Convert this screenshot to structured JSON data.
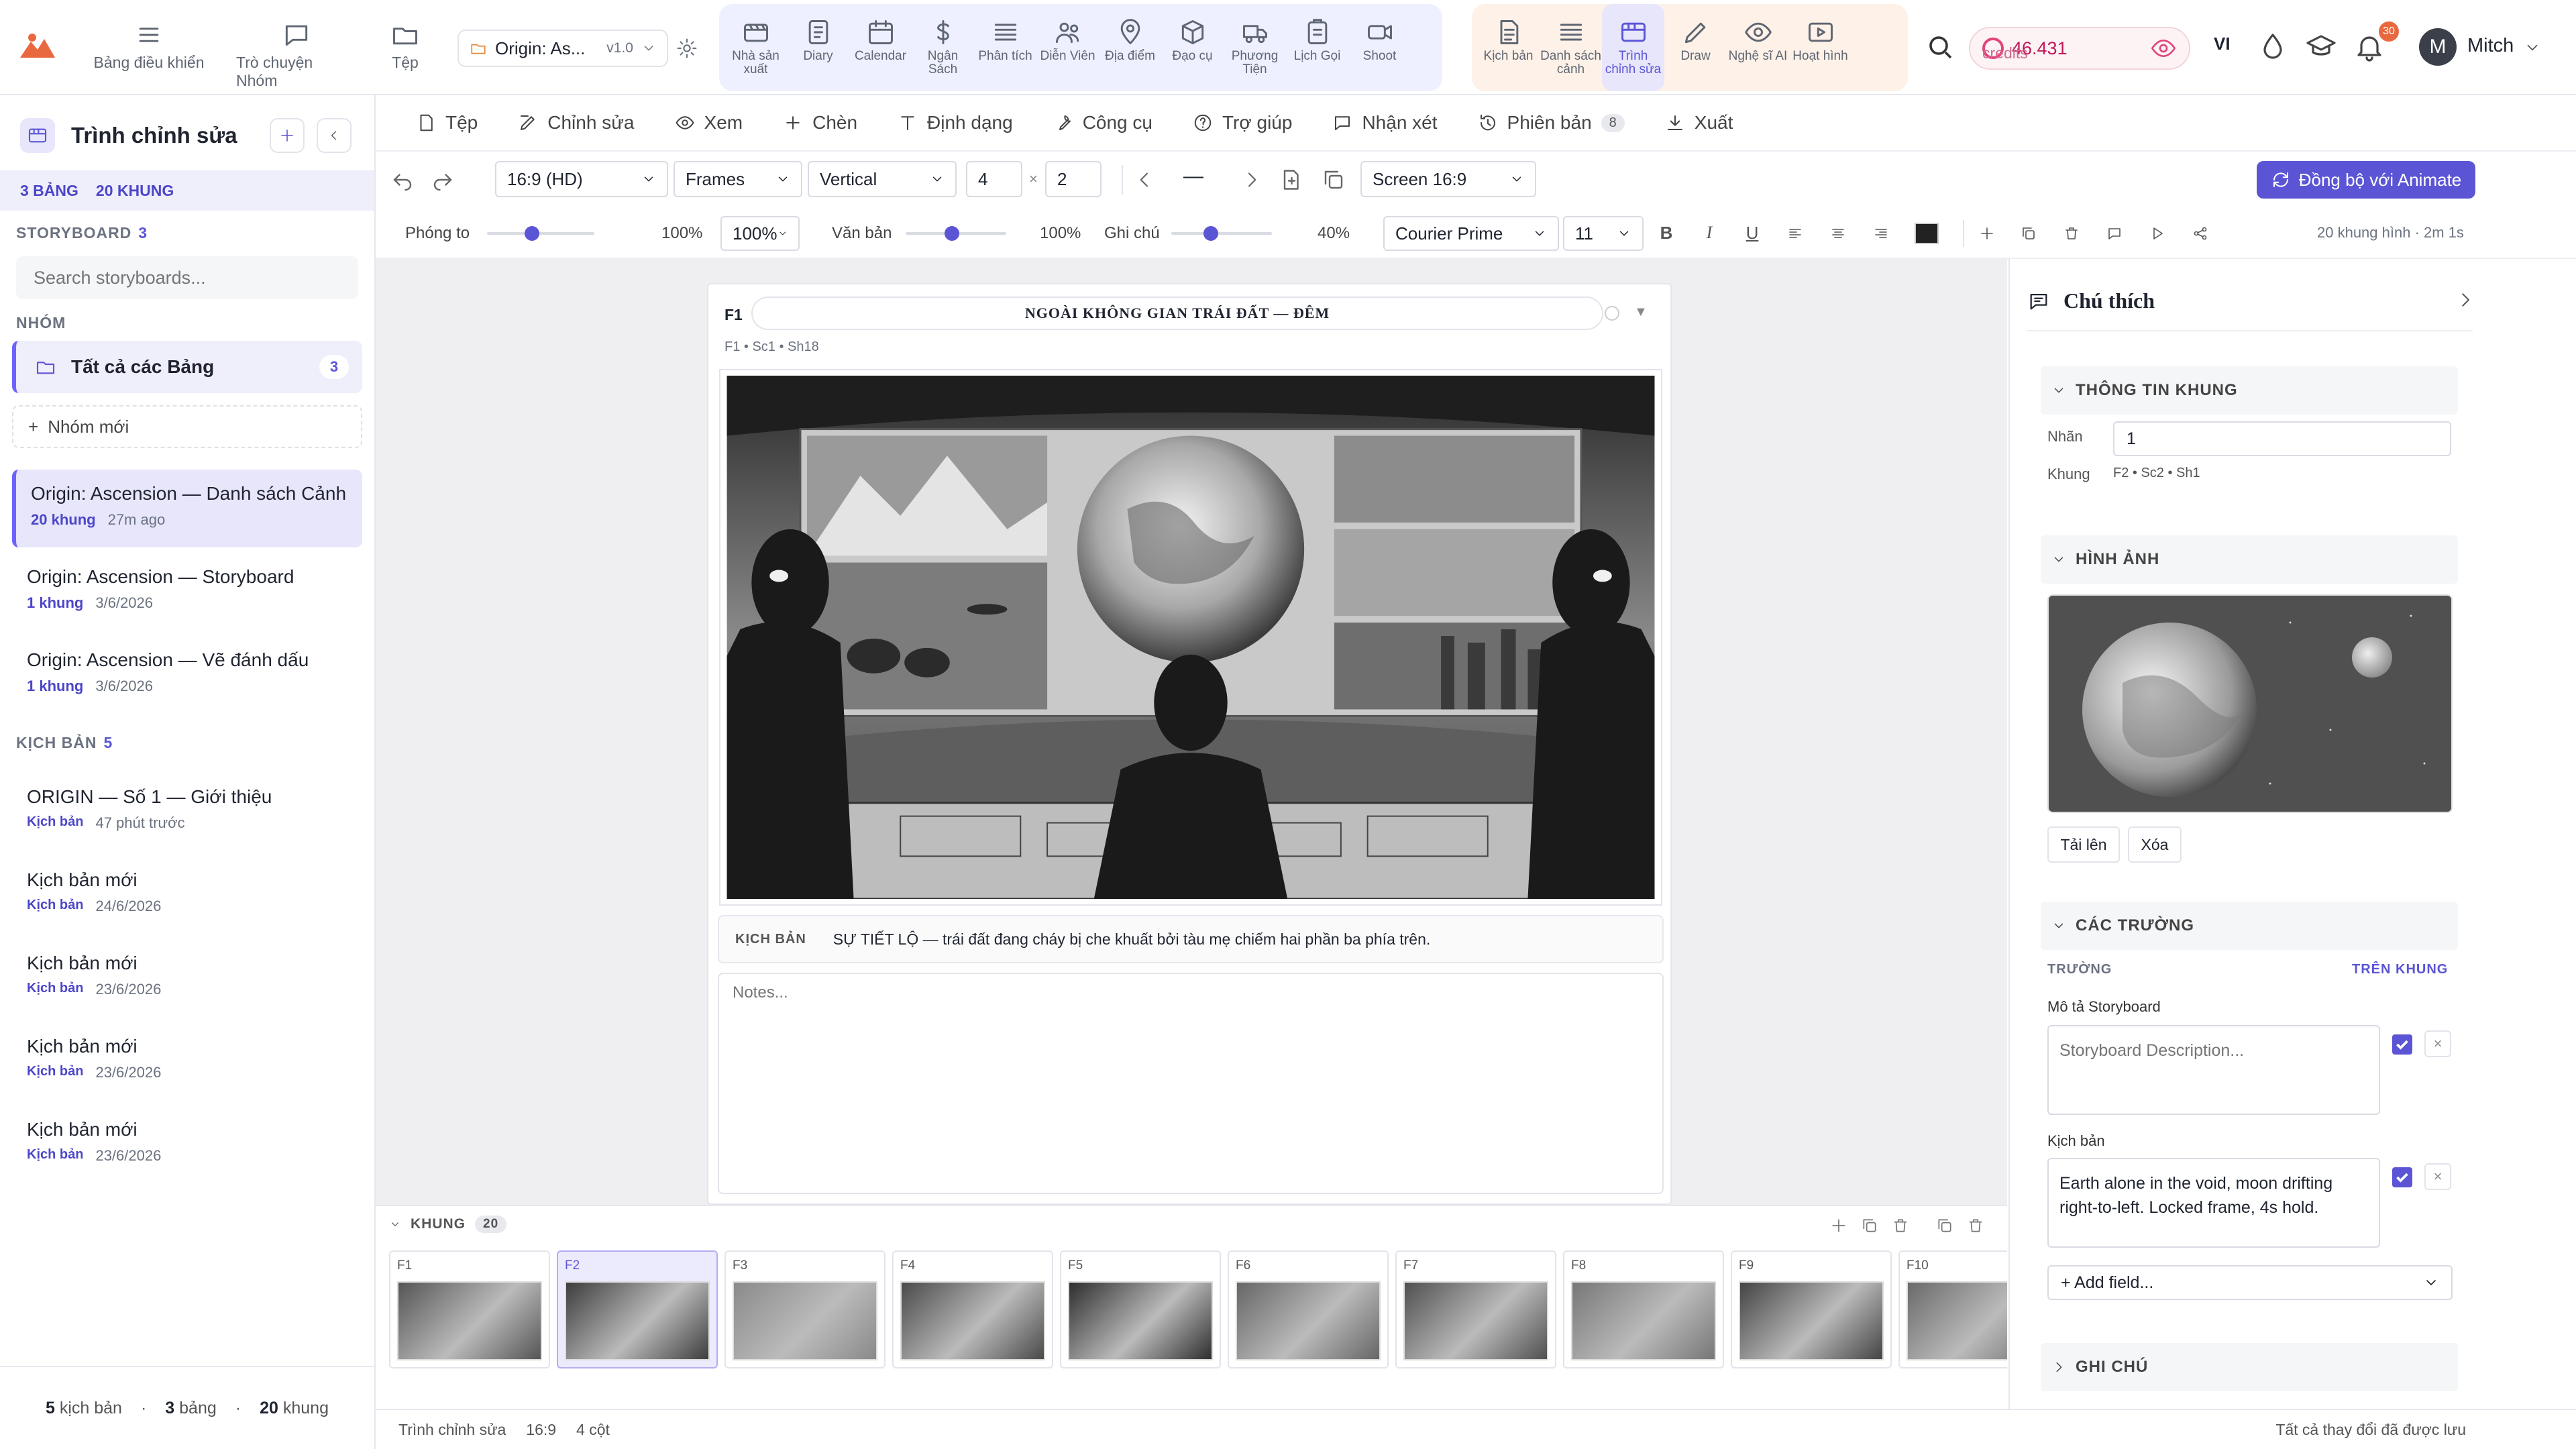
{
  "topbar": {
    "nav": [
      {
        "label": "Bảng điều khiển",
        "icon": "menu-icon"
      },
      {
        "label": "Trò chuyện Nhóm",
        "icon": "chat-icon"
      },
      {
        "label": "Tệp",
        "icon": "folder-icon"
      }
    ],
    "project": {
      "name": "Origin: As...",
      "version": "v1.0"
    },
    "tools": [
      {
        "label": "Nhà sản xuất",
        "icon": "producer-icon"
      },
      {
        "label": "Diary",
        "icon": "diary-icon"
      },
      {
        "label": "Calendar",
        "icon": "calendar-icon"
      },
      {
        "label": "Ngân Sách",
        "icon": "dollar-icon"
      },
      {
        "label": "Phân tích",
        "icon": "breakdown-icon"
      },
      {
        "label": "Diễn Viên",
        "icon": "cast-icon"
      },
      {
        "label": "Địa điểm",
        "icon": "location-icon"
      },
      {
        "label": "Đạo cụ",
        "icon": "props-icon"
      },
      {
        "label": "Phương Tiện",
        "icon": "vehicle-icon"
      },
      {
        "label": "Lịch Gọi",
        "icon": "callsheet-icon"
      },
      {
        "label": "Shoot",
        "icon": "camera-icon"
      }
    ],
    "tools2": [
      {
        "label": "Kịch bản",
        "icon": "script-icon"
      },
      {
        "label": "Danh sách cảnh",
        "icon": "list-icon"
      },
      {
        "label": "Trình chỉnh sửa",
        "icon": "storyboard-icon",
        "active": true
      },
      {
        "label": "Draw",
        "icon": "pen-icon"
      },
      {
        "label": "Nghệ sĩ AI",
        "icon": "eye-icon"
      },
      {
        "label": "Hoạt hình",
        "icon": "play-icon"
      }
    ],
    "credits": {
      "value": "46.431",
      "label": "credits"
    },
    "lang": "VI",
    "notif_count": "30",
    "user": {
      "initial": "M",
      "name": "Mitch"
    }
  },
  "sidebar": {
    "title": "Trình chỉnh sửa",
    "stats": {
      "boards": "3 BẢNG",
      "frames": "20 KHUNG"
    },
    "storyboard_label": "STORYBOARD",
    "storyboard_count": "3",
    "search_placeholder": "Search storyboards...",
    "group_label": "NHÓM",
    "all_boards": {
      "label": "Tất cả các Bảng",
      "count": "3"
    },
    "new_group": "Nhóm mới",
    "boards": [
      {
        "name": "Origin: Ascension — Danh sách Cảnh",
        "meta1": "20 khung",
        "meta2": "27m ago"
      },
      {
        "name": "Origin: Ascension — Storyboard",
        "meta1": "1 khung",
        "meta2": "3/6/2026"
      },
      {
        "name": "Origin: Ascension — Vẽ đánh dấu",
        "meta1": "1 khung",
        "meta2": "3/6/2026"
      }
    ],
    "script_label": "KỊCH BẢN",
    "script_count": "5",
    "scripts": [
      {
        "name": "ORIGIN — Số 1 — Giới thiệu",
        "meta1": "Kịch bản",
        "meta2": "47 phút trước"
      },
      {
        "name": "Kịch bản mới",
        "meta1": "Kịch bản",
        "meta2": "24/6/2026"
      },
      {
        "name": "Kịch bản mới",
        "meta1": "Kịch bản",
        "meta2": "23/6/2026"
      },
      {
        "name": "Kịch bản mới",
        "meta1": "Kịch bản",
        "meta2": "23/6/2026"
      },
      {
        "name": "Kịch bản mới",
        "meta1": "Kịch bản",
        "meta2": "23/6/2026"
      }
    ],
    "footer": {
      "scripts_n": "5",
      "scripts_l": "kịch bản",
      "boards_n": "3",
      "boards_l": "bảng",
      "frames_n": "20",
      "frames_l": "khung"
    }
  },
  "menu": [
    {
      "label": "Tệp",
      "icon": "file-icon"
    },
    {
      "label": "Chỉnh sửa",
      "icon": "edit-icon"
    },
    {
      "label": "Xem",
      "icon": "eye-icon"
    },
    {
      "label": "Chèn",
      "icon": "plus-icon"
    },
    {
      "label": "Định dạng",
      "icon": "text-icon"
    },
    {
      "label": "Công cụ",
      "icon": "wrench-icon"
    },
    {
      "label": "Trợ giúp",
      "icon": "help-icon"
    },
    {
      "label": "Nhận xét",
      "icon": "comment-icon"
    },
    {
      "label": "Phiên bản",
      "icon": "history-icon",
      "badge": "8"
    },
    {
      "label": "Xuất",
      "icon": "download-icon"
    }
  ],
  "toolbar": {
    "aspect": "16:9 (HD)",
    "mode": "Frames",
    "orientation": "Vertical",
    "cols": "4",
    "times": "×",
    "rows": "2",
    "zoom_dash": "—",
    "screen": "Screen 16:9",
    "sync_label": "Đồng bộ với Animate"
  },
  "toolbar2": {
    "zoom_label": "Phóng to",
    "zoom_value": "100%",
    "zoom_select": "100%",
    "text_label": "Văn bản",
    "text_value": "100%",
    "notes_label": "Ghi chú",
    "notes_value": "40%",
    "font": "Courier Prime",
    "size": "11",
    "bold": "B",
    "italic": "I",
    "underline": "U",
    "info": "20 khung hình · 2m 1s"
  },
  "frame": {
    "id": "F1",
    "heading": "NGOÀI KHÔNG GIAN TRÁI ĐẤT — ĐÊM",
    "sub": "F1 • Sc1 • Sh18",
    "script_label": "KỊCH BẢN",
    "script_text": "SỰ TIẾT LỘ — trái đất đang cháy bị che khuất bởi tàu mẹ chiếm hai phần ba phía trên.",
    "notes_placeholder": "Notes..."
  },
  "strip": {
    "label": "KHUNG",
    "count": "20",
    "frames": [
      "F1",
      "F2",
      "F3",
      "F4",
      "F5",
      "F6",
      "F7",
      "F8",
      "F9",
      "F10"
    ],
    "active": "F2"
  },
  "status": {
    "mode": "Trình chỉnh sửa",
    "ratio": "16:9",
    "cols": "4 cột",
    "saved": "Tất cả thay đổi đã được lưu"
  },
  "panel": {
    "title": "Chú thích",
    "frame_info": "THÔNG TIN KHUNG",
    "label_k": "Nhãn",
    "label_v": "1",
    "frame_k": "Khung",
    "frame_v": "F2 • Sc2 • Sh1",
    "image_section": "HÌNH ẢNH",
    "upload": "Tải lên",
    "delete": "Xóa",
    "fields_section": "CÁC TRƯỜNG",
    "field_col": "TRƯỜNG",
    "on_frame_col": "TRÊN KHUNG",
    "desc_label": "Mô tả Storyboard",
    "desc_placeholder": "Storyboard Description...",
    "script_label": "Kịch bản",
    "script_value": "Earth alone in the void, moon drifting right-to-left. Locked frame, 4s hold.",
    "add_field": "+ Add field...",
    "notes_section": "GHI CHÚ"
  },
  "colors": {
    "accent": "#5b55d6",
    "credits": "#e0457b",
    "logo": "#e8683f"
  }
}
